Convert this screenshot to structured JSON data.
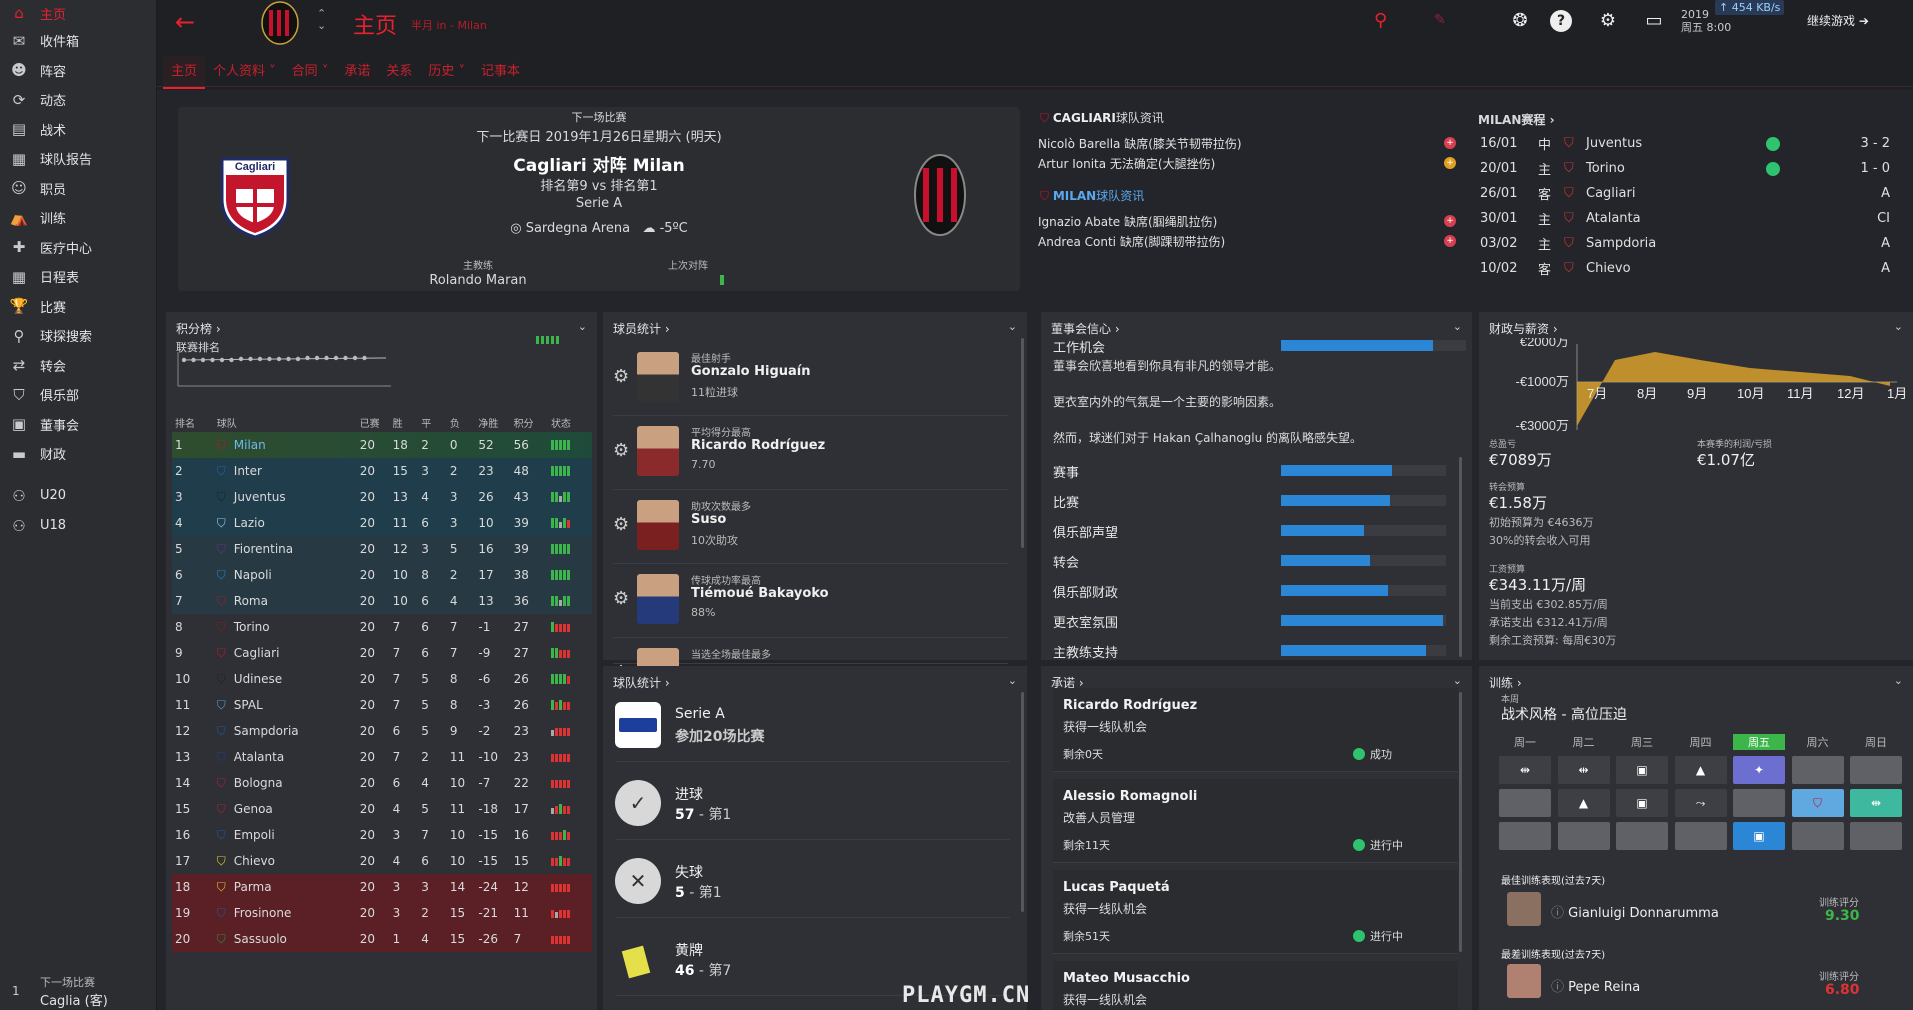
{
  "sidebar": {
    "items": [
      {
        "label": "主页",
        "icon": "home-icon"
      },
      {
        "label": "收件箱",
        "icon": "inbox-icon"
      },
      {
        "label": "阵容",
        "icon": "squad-icon"
      },
      {
        "label": "动态",
        "icon": "dynamics-icon"
      },
      {
        "label": "战术",
        "icon": "tactics-icon"
      },
      {
        "label": "球队报告",
        "icon": "report-icon"
      },
      {
        "label": "职员",
        "icon": "staff-icon"
      },
      {
        "label": "训练",
        "icon": "training-icon"
      },
      {
        "label": "医疗中心",
        "icon": "medical-icon"
      },
      {
        "label": "日程表",
        "icon": "calendar-icon"
      },
      {
        "label": "比赛",
        "icon": "trophy-icon"
      },
      {
        "label": "球探搜索",
        "icon": "scouting-icon"
      },
      {
        "label": "转会",
        "icon": "transfer-icon"
      },
      {
        "label": "俱乐部",
        "icon": "club-icon"
      },
      {
        "label": "董事会",
        "icon": "board-icon"
      },
      {
        "label": "财政",
        "icon": "finance-icon"
      },
      {
        "label": "U20",
        "icon": "u20-icon"
      },
      {
        "label": "U18",
        "icon": "u18-icon"
      }
    ],
    "next_match_label": "下一场比赛",
    "next_match_value": "Caglia (客)",
    "next_match_num": "1"
  },
  "topbar": {
    "title": "主页",
    "subtitle": "半月 in - Milan",
    "date_year": "2019",
    "date_day": "周五 8:00",
    "net": "454 KB/s",
    "continue": "继续游戏"
  },
  "tabs": [
    "主页",
    "个人资料",
    "合同",
    "承诺",
    "关系",
    "历史",
    "记事本"
  ],
  "match": {
    "header": "下一场比赛",
    "date": "下一比赛日 2019年1月26日星期六 (明天)",
    "teams": "Cagliari 对阵 Milan",
    "rank": "排名第9 vs 排名第1",
    "competition": "Serie A",
    "stadium": "Sardegna Arena",
    "weather": "-5ºC",
    "coach_label": "主教练",
    "coach": "Rolando Maran",
    "last_label": "上次对阵"
  },
  "news": {
    "cag_title_team": "CAGLIARI",
    "cag_title": "球队资讯",
    "cag_items": [
      {
        "text": "Nicolò Barella 缺席(膝关节韧带拉伤)",
        "type": "injury"
      },
      {
        "text": "Artur Ionita 无法确定(大腿挫伤)",
        "type": "doubt"
      }
    ],
    "mil_title_team": "MILAN",
    "mil_title": "球队资讯",
    "mil_items": [
      {
        "text": "Ignazio Abate 缺席(腘绳肌拉伤)",
        "type": "injury"
      },
      {
        "text": "Andrea Conti 缺席(脚踝韧带拉伤)",
        "type": "injury"
      }
    ]
  },
  "fixtures": {
    "title": "MILAN赛程",
    "rows": [
      {
        "date": "16/01",
        "venue": "中",
        "team": "Juventus",
        "result": "3 - 2",
        "win": true
      },
      {
        "date": "20/01",
        "venue": "主",
        "team": "Torino",
        "result": "1 - 0",
        "win": true
      },
      {
        "date": "26/01",
        "venue": "客",
        "team": "Cagliari",
        "result": "A",
        "win": false
      },
      {
        "date": "30/01",
        "venue": "主",
        "team": "Atalanta",
        "result": "CI",
        "win": false
      },
      {
        "date": "03/02",
        "venue": "主",
        "team": "Sampdoria",
        "result": "A",
        "win": false
      },
      {
        "date": "10/02",
        "venue": "客",
        "team": "Chievo",
        "result": "A",
        "win": false
      }
    ]
  },
  "standings": {
    "title": "积分榜",
    "sub": "联赛排名",
    "headers": [
      "排名",
      "球队",
      "已赛",
      "胜",
      "平",
      "负",
      "净胜",
      "积分",
      "状态"
    ],
    "rows": [
      [
        "1",
        "Milan",
        "20",
        "18",
        "2",
        "0",
        "52",
        "56",
        "wwwww"
      ],
      [
        "2",
        "Inter",
        "20",
        "15",
        "3",
        "2",
        "23",
        "48",
        "wwwww"
      ],
      [
        "3",
        "Juventus",
        "20",
        "13",
        "4",
        "3",
        "26",
        "43",
        "wwdww"
      ],
      [
        "4",
        "Lazio",
        "20",
        "11",
        "6",
        "3",
        "10",
        "39",
        "wwdwl"
      ],
      [
        "5",
        "Fiorentina",
        "20",
        "12",
        "3",
        "5",
        "16",
        "39",
        "wwwww"
      ],
      [
        "6",
        "Napoli",
        "20",
        "10",
        "8",
        "2",
        "17",
        "38",
        "wwwww"
      ],
      [
        "7",
        "Roma",
        "20",
        "10",
        "6",
        "4",
        "13",
        "36",
        "wwdww"
      ],
      [
        "8",
        "Torino",
        "20",
        "7",
        "6",
        "7",
        "-1",
        "27",
        "wllll"
      ],
      [
        "9",
        "Cagliari",
        "20",
        "7",
        "6",
        "7",
        "-9",
        "27",
        "wwlll"
      ],
      [
        "10",
        "Udinese",
        "20",
        "7",
        "5",
        "8",
        "-6",
        "26",
        "wwwwl"
      ],
      [
        "11",
        "SPAL",
        "20",
        "7",
        "5",
        "8",
        "-3",
        "26",
        "wlwll"
      ],
      [
        "12",
        "Sampdoria",
        "20",
        "6",
        "5",
        "9",
        "-2",
        "23",
        "dllll"
      ],
      [
        "13",
        "Atalanta",
        "20",
        "7",
        "2",
        "11",
        "-10",
        "23",
        "lllll"
      ],
      [
        "14",
        "Bologna",
        "20",
        "6",
        "4",
        "10",
        "-7",
        "22",
        "lllll"
      ],
      [
        "15",
        "Genoa",
        "20",
        "4",
        "5",
        "11",
        "-18",
        "17",
        "dlwll"
      ],
      [
        "16",
        "Empoli",
        "20",
        "3",
        "7",
        "10",
        "-15",
        "16",
        "lllwl"
      ],
      [
        "17",
        "Chievo",
        "20",
        "4",
        "6",
        "10",
        "-15",
        "15",
        "llwll"
      ],
      [
        "18",
        "Parma",
        "20",
        "3",
        "3",
        "14",
        "-24",
        "12",
        "lllll"
      ],
      [
        "19",
        "Frosinone",
        "20",
        "3",
        "2",
        "15",
        "-21",
        "11",
        "ldlll"
      ],
      [
        "20",
        "Sassuolo",
        "20",
        "1",
        "4",
        "15",
        "-26",
        "7",
        "lllll"
      ]
    ]
  },
  "player_stats": {
    "title": "球员统计",
    "rows": [
      {
        "cat": "最佳射手",
        "name": "Gonzalo Higuaín",
        "val": "11粒进球"
      },
      {
        "cat": "平均得分最高",
        "name": "Ricardo Rodríguez",
        "val": "7.70"
      },
      {
        "cat": "助攻次数最多",
        "name": "Suso",
        "val": "10次助攻"
      },
      {
        "cat": "传球成功率最高",
        "name": "Tiémoué Bakayoko",
        "val": "88%"
      },
      {
        "cat": "当选全场最佳最多",
        "name": "",
        "val": ""
      }
    ]
  },
  "team_stats": {
    "title": "球队统计",
    "rows": [
      {
        "label": "Serie A",
        "val": "参加20场比赛"
      },
      {
        "label": "进球",
        "val": "57",
        "rank": "第1"
      },
      {
        "label": "失球",
        "val": "5",
        "rank": "第1"
      },
      {
        "label": "黄牌",
        "val": "46",
        "rank": "第7"
      }
    ]
  },
  "board": {
    "title": "董事会信心",
    "main_label": "工作机会",
    "main_value": 0.82,
    "texts": [
      "董事会欣喜地看到你具有非凡的领导才能。",
      "更衣室内外的气氛是一个主要的影响因素。",
      "然而，球迷们对于 Hakan Çalhanoglu 的离队略感失望。"
    ],
    "bars": [
      {
        "label": "赛事",
        "value": 0.67
      },
      {
        "label": "比赛",
        "value": 0.66
      },
      {
        "label": "俱乐部声望",
        "value": 0.5
      },
      {
        "label": "转会",
        "value": 0.54
      },
      {
        "label": "俱乐部财政",
        "value": 0.65
      },
      {
        "label": "更衣室氛围",
        "value": 0.98
      },
      {
        "label": "主教练支持",
        "value": 0.88
      }
    ]
  },
  "promises": {
    "title": "承诺",
    "items": [
      {
        "name": "Ricardo Rodríguez",
        "desc": "获得一线队机会",
        "left": "剩余0天",
        "status": "成功"
      },
      {
        "name": "Alessio Romagnoli",
        "desc": "改善人员管理",
        "left": "剩余11天",
        "status": "进行中"
      },
      {
        "name": "Lucas Paquetá",
        "desc": "获得一线队机会",
        "left": "剩余51天",
        "status": "进行中"
      },
      {
        "name": "Mateo Musacchio",
        "desc": "获得一线队机会",
        "left": "",
        "status": ""
      }
    ]
  },
  "finance": {
    "title": "财政与薪资",
    "y_ticks": [
      "€2000万",
      "-€1000万",
      "-€3000万"
    ],
    "months": [
      "7月",
      "8月",
      "9月",
      "10月",
      "11月",
      "12月",
      "1月"
    ],
    "balance_label": "总盈亏",
    "balance": "€7089万",
    "profit_label": "本赛季的利润/亏损",
    "profit": "€1.07亿",
    "transfer_label": "转会预算",
    "transfer": "€1.58万",
    "transfer_init": "初始预算为 €4636万",
    "transfer_pct": "30%的转会收入可用",
    "wage_label": "工资预算",
    "wage": "€343.11万/周",
    "wage_current": "当前支出 €302.85万/周",
    "wage_promised": "承诺支出 €312.41万/周",
    "wage_left": "剩余工资预算: 每周€30万"
  },
  "training": {
    "title": "训练",
    "sub": "本周",
    "style": "战术风格 - 高位压迫",
    "days": [
      "周一",
      "周二",
      "周三",
      "周四",
      "周五",
      "周六",
      "周日"
    ],
    "best_label": "最佳训练表现(过去7天)",
    "best_name": "Gianluigi Donnarumma",
    "best_score_label": "训练评分",
    "best_score": "9.30",
    "worst_label": "最差训练表现(过去7天)",
    "worst_name": "Pepe Reina",
    "worst_score_label": "训练评分",
    "worst_score": "6.80"
  },
  "watermark": "PLAYGM.CN",
  "colors": {
    "accent": "#e8212e",
    "bar": "#2b87d6",
    "win": "#3cb54a",
    "loss": "#d33"
  }
}
